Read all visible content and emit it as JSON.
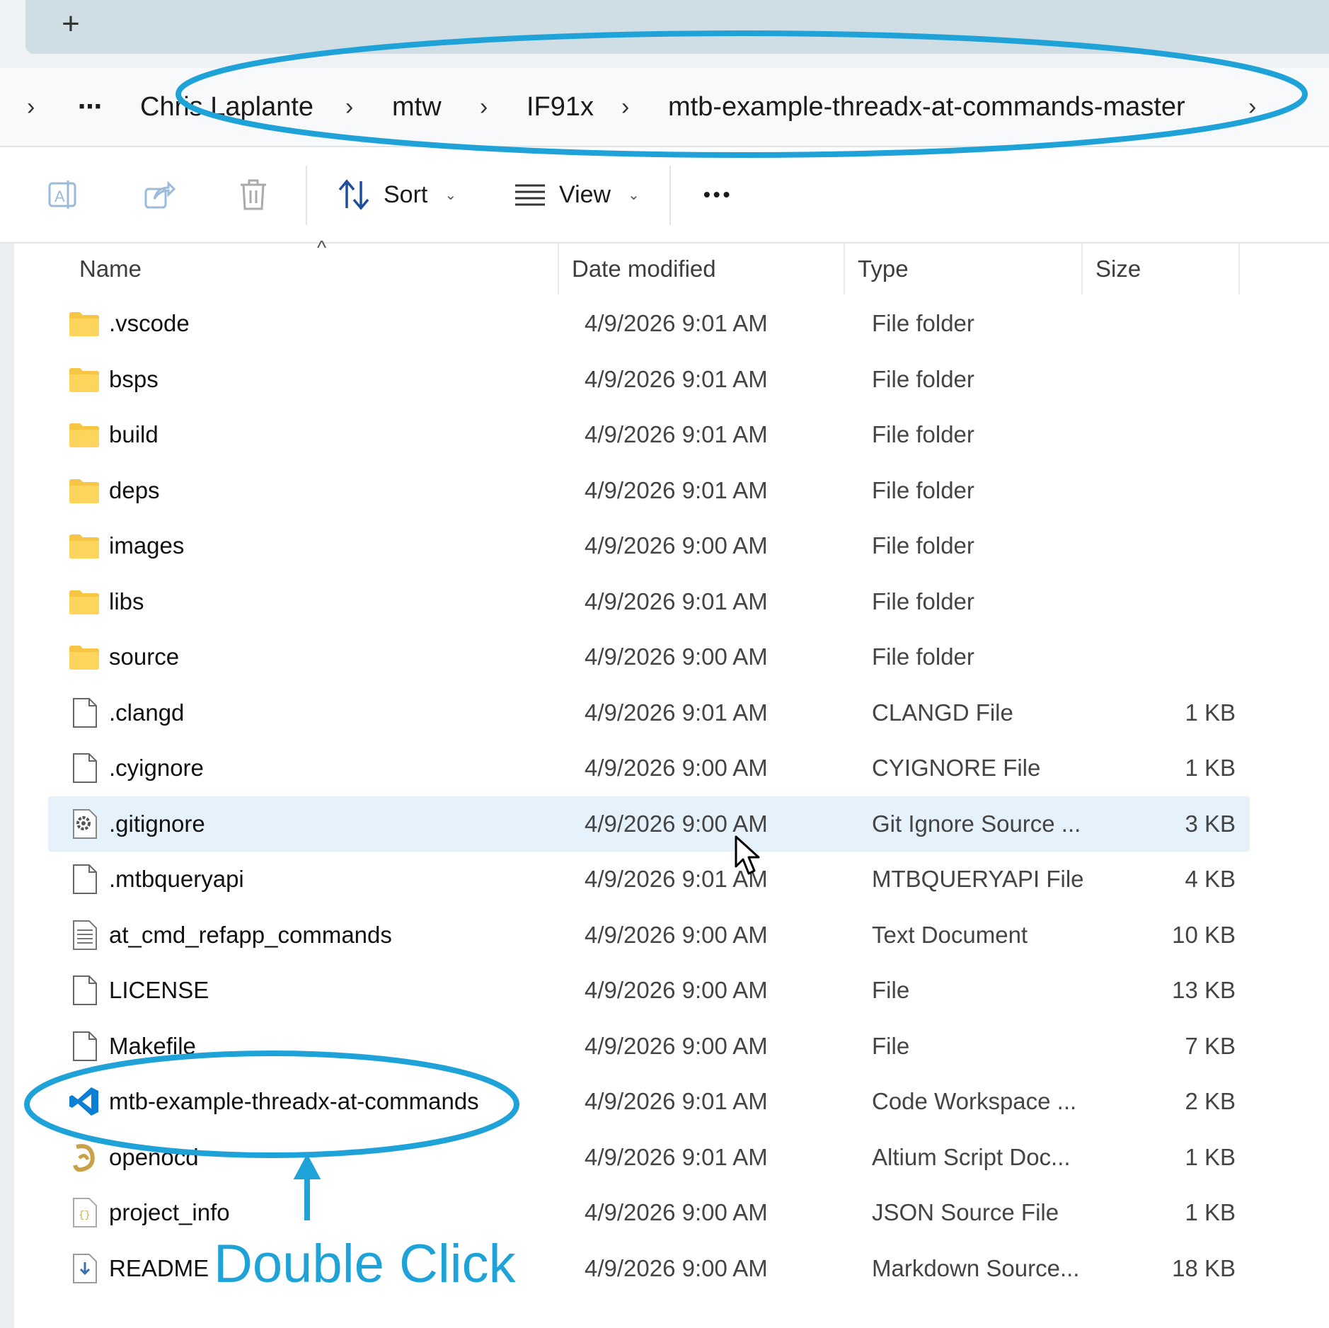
{
  "tabstrip": {
    "new_tab": "+"
  },
  "address": {
    "expand_chevron": "›",
    "overflow": "⋯",
    "crumbs": [
      "Chris.Laplante",
      "mtw",
      "IF91x",
      "mtb-example-threadx-at-commands-master"
    ],
    "separator": "›"
  },
  "commandbar": {
    "sort_label": "Sort",
    "view_label": "View",
    "more_label": "•••"
  },
  "columns": {
    "name": "Name",
    "date": "Date modified",
    "type": "Type",
    "size": "Size"
  },
  "rows": [
    {
      "name": ".vscode",
      "date": "4/9/2026 9:01 AM",
      "type": "File folder",
      "size": "",
      "icon": "folder-icon"
    },
    {
      "name": "bsps",
      "date": "4/9/2026 9:01 AM",
      "type": "File folder",
      "size": "",
      "icon": "folder-icon"
    },
    {
      "name": "build",
      "date": "4/9/2026 9:01 AM",
      "type": "File folder",
      "size": "",
      "icon": "folder-icon"
    },
    {
      "name": "deps",
      "date": "4/9/2026 9:01 AM",
      "type": "File folder",
      "size": "",
      "icon": "folder-icon"
    },
    {
      "name": "images",
      "date": "4/9/2026 9:00 AM",
      "type": "File folder",
      "size": "",
      "icon": "folder-icon"
    },
    {
      "name": "libs",
      "date": "4/9/2026 9:01 AM",
      "type": "File folder",
      "size": "",
      "icon": "folder-icon"
    },
    {
      "name": "source",
      "date": "4/9/2026 9:00 AM",
      "type": "File folder",
      "size": "",
      "icon": "folder-icon"
    },
    {
      "name": ".clangd",
      "date": "4/9/2026 9:01 AM",
      "type": "CLANGD File",
      "size": "1 KB",
      "icon": "file-icon"
    },
    {
      "name": ".cyignore",
      "date": "4/9/2026 9:00 AM",
      "type": "CYIGNORE File",
      "size": "1 KB",
      "icon": "file-icon"
    },
    {
      "name": ".gitignore",
      "date": "4/9/2026 9:00 AM",
      "type": "Git Ignore Source ...",
      "size": "3 KB",
      "icon": "gear-file-icon"
    },
    {
      "name": ".mtbqueryapi",
      "date": "4/9/2026 9:01 AM",
      "type": "MTBQUERYAPI File",
      "size": "4 KB",
      "icon": "file-icon"
    },
    {
      "name": "at_cmd_refapp_commands",
      "date": "4/9/2026 9:00 AM",
      "type": "Text Document",
      "size": "10 KB",
      "icon": "text-file-icon"
    },
    {
      "name": "LICENSE",
      "date": "4/9/2026 9:00 AM",
      "type": "File",
      "size": "13 KB",
      "icon": "file-icon"
    },
    {
      "name": "Makefile",
      "date": "4/9/2026 9:00 AM",
      "type": "File",
      "size": "7 KB",
      "icon": "file-icon"
    },
    {
      "name": "mtb-example-threadx-at-commands",
      "date": "4/9/2026 9:01 AM",
      "type": "Code Workspace ...",
      "size": "2 KB",
      "icon": "vscode-icon"
    },
    {
      "name": "openocd",
      "date": "4/9/2026 9:01 AM",
      "type": "Altium Script Doc...",
      "size": "1 KB",
      "icon": "altium-icon"
    },
    {
      "name": "project_info",
      "date": "4/9/2026 9:00 AM",
      "type": "JSON Source File",
      "size": "1 KB",
      "icon": "json-file-icon"
    },
    {
      "name": "README",
      "date": "4/9/2026 9:00 AM",
      "type": "Markdown Source...",
      "size": "18 KB",
      "icon": "markdown-file-icon"
    }
  ],
  "hover_row": 9,
  "annotation": {
    "label": "Double Click",
    "color": "#1ea2d8"
  },
  "colors": {
    "folder": "#f6c544",
    "hover": "#e5f1fb",
    "annotation": "#1ea2d8",
    "vscode": "#0a7fd4"
  }
}
